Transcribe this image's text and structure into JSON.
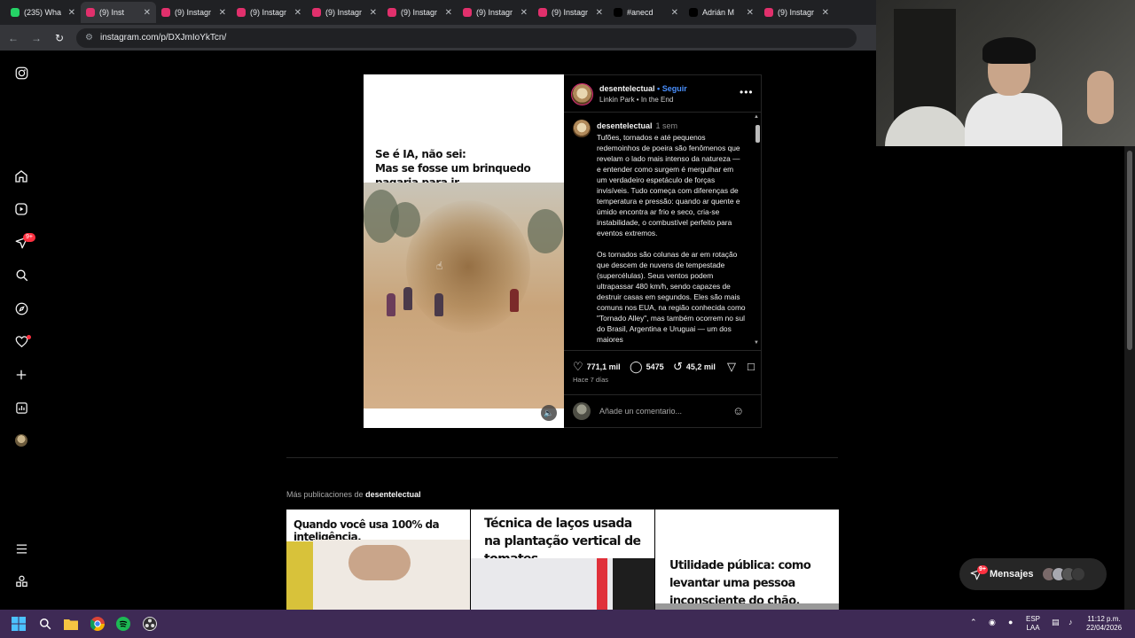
{
  "browser": {
    "tabs": [
      {
        "label": "(235) Wha",
        "color": "#25d366",
        "active": false
      },
      {
        "label": "(9) Inst",
        "color": "#e1306c",
        "active": true
      },
      {
        "label": "(9) Instagr",
        "color": "#e1306c",
        "active": false
      },
      {
        "label": "(9) Instagr",
        "color": "#e1306c",
        "active": false
      },
      {
        "label": "(9) Instagr",
        "color": "#e1306c",
        "active": false
      },
      {
        "label": "(9) Instagr",
        "color": "#e1306c",
        "active": false
      },
      {
        "label": "(9) Instagr",
        "color": "#e1306c",
        "active": false
      },
      {
        "label": "(9) Instagr",
        "color": "#e1306c",
        "active": false
      },
      {
        "label": "#anecd",
        "color": "#000000",
        "active": false
      },
      {
        "label": "Adrián M",
        "color": "#000000",
        "active": false
      },
      {
        "label": "(9) Instagr",
        "color": "#e1306c",
        "active": false
      }
    ],
    "url": "instagram.com/p/DXJmIoYkTcn/"
  },
  "nav": {
    "notifications_badge": "9+"
  },
  "media": {
    "overlay_text_line1": "Se é IA, não sei:",
    "overlay_text_line2": "Mas se fosse um brinquedo pagaria para ir."
  },
  "post": {
    "username": "desentelectual",
    "follow_label": "Seguir",
    "separator": "•",
    "audio": "Linkin Park • In the End",
    "caption_user": "desentelectual",
    "caption_time": "1 sem",
    "caption_p1": "Tufões, tornados e até pequenos redemoinhos de poeira são fenômenos que revelam o lado mais intenso da natureza — e entender como surgem é mergulhar em um verdadeiro espetáculo de forças invisíveis. Tudo começa com diferenças de temperatura e pressão: quando ar quente e úmido encontra ar frio e seco, cria-se instabilidade, o combustível perfeito para eventos extremos.",
    "caption_p2": "Os tornados são colunas de ar em rotação que descem de nuvens de tempestade (supercélulas). Seus ventos podem ultrapassar 480 km/h, sendo capazes de destruir casas em segundos. Eles são mais comuns nos EUA, na região conhecida como \"Tornado Alley\", mas também ocorrem no sul do Brasil, Argentina e Uruguai — um dos maiores",
    "likes": "771,1 mil",
    "comments": "5475",
    "reposts": "45,2 mil",
    "ago": "Hace 7 días",
    "comment_placeholder": "Añade un comentario..."
  },
  "more": {
    "prefix": "Más publicaciones de",
    "user": "desentelectual",
    "thumbs": [
      {
        "text": "Quando você usa 100% da inteligência."
      },
      {
        "text": "Técnica de laços usada na plantação vertical de tomates."
      },
      {
        "text": "Utilidade pública: como levantar uma pessoa inconsciente do chão."
      }
    ]
  },
  "messages": {
    "label": "Mensajes",
    "badge": "9+"
  },
  "taskbar": {
    "lang_line1": "ESP",
    "lang_line2": "LAA",
    "time": "11:12 p.m.",
    "date": "22/04/2026"
  },
  "colors": {
    "accent_blue": "#4a90ff",
    "badge_red": "#ff3040",
    "taskbar": "#3e2a55"
  }
}
